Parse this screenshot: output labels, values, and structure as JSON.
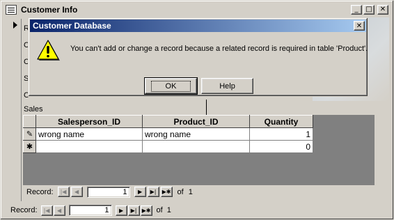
{
  "window": {
    "title": "Customer Info",
    "minimize_glyph": "_",
    "maximize_glyph": "□",
    "close_glyph": "✕"
  },
  "form": {
    "field_labels": [
      "R",
      "C",
      "C",
      "S",
      "C"
    ],
    "sales_label": "Sales"
  },
  "subform": {
    "columns": [
      "Salesperson_ID",
      "Product_ID",
      "Quantity"
    ],
    "rows": [
      {
        "selector": "✎",
        "salesperson_id": "wrong name",
        "product_id": "wrong name",
        "quantity": "1"
      },
      {
        "selector": "✱",
        "salesperson_id": "",
        "product_id": "",
        "quantity": "0"
      }
    ],
    "nav": {
      "label": "Record:",
      "current": "1",
      "of_label": "of",
      "total": "1"
    }
  },
  "main_nav": {
    "label": "Record:",
    "current": "1",
    "of_label": "of",
    "total": "1"
  },
  "nav_glyphs": {
    "first": "|◀",
    "prev": "◀",
    "next": "▶",
    "last": "▶|",
    "new": "▶✱"
  },
  "dialog": {
    "title": "Customer Database",
    "message": "You can't add or change a record because a related record is required in table 'Product'.",
    "ok_label": "OK",
    "help_label": "Help",
    "close_glyph": "✕",
    "icon": "warning-icon"
  },
  "colors": {
    "titlebar_active_start": "#0a246a",
    "titlebar_active_end": "#a6caf0",
    "face": "#d4d0c8",
    "warning_yellow": "#ffff00"
  }
}
